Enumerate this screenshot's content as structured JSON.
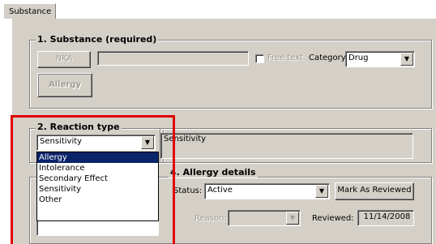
{
  "tab": {
    "label": "Substance"
  },
  "substance": {
    "legend": "1. Substance (required)",
    "nka_button": "NKA",
    "substance_value": "",
    "free_text_label": "Free text",
    "category_label": "Category:",
    "category_value": "Drug",
    "allergy_button": "Allergy"
  },
  "reaction": {
    "legend": "2. Reaction type",
    "selected_value": "Sensitivity",
    "display_value": "Sensitivity",
    "options": [
      "Allergy",
      "Intolerance",
      "Secondary Effect",
      "Sensitivity",
      "Other"
    ],
    "highlighted_option": "Allergy"
  },
  "details": {
    "legend": "4. Allergy details",
    "status_label": "Status:",
    "status_value": "Active",
    "mark_reviewed_button": "Mark As Reviewed",
    "reason_label": "Reason:",
    "reason_value": "",
    "reviewed_label": "Reviewed:",
    "reviewed_value": "11/14/2008"
  },
  "colors": {
    "highlight": "#0a246a",
    "annotation": "#e00000",
    "panel": "#d4d0c8"
  },
  "icons": {
    "dropdown": "chevron-down-icon"
  }
}
